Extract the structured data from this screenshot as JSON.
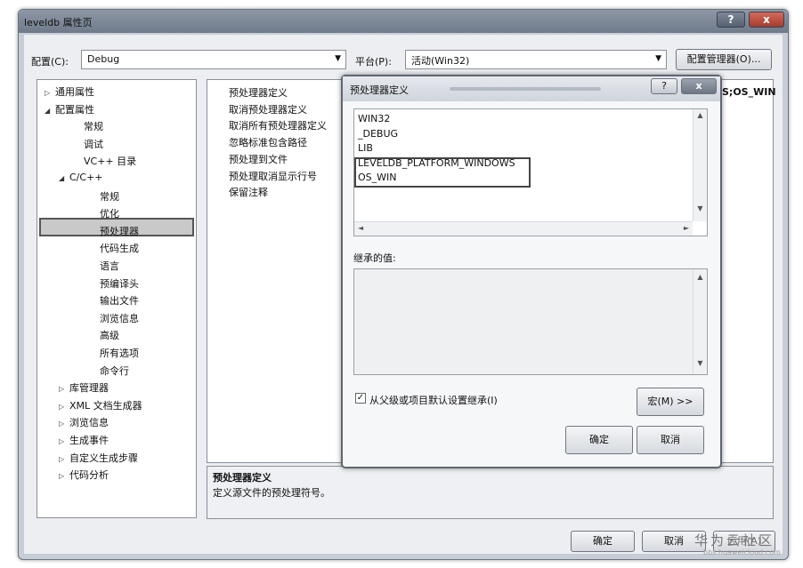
{
  "window": {
    "title": "leveldb 属性页",
    "help_label": "?",
    "close_label": "x"
  },
  "toolbar": {
    "config_label": "配置(C):",
    "config_value": "Debug",
    "platform_label": "平台(P):",
    "platform_value": "活动(Win32)",
    "config_manager_label": "配置管理器(O)..."
  },
  "tree": {
    "items": [
      {
        "label": "通用属性",
        "exp": "▷"
      },
      {
        "label": "配置属性",
        "exp": "◢"
      },
      {
        "label": "常规",
        "exp": ""
      },
      {
        "label": "调试",
        "exp": ""
      },
      {
        "label": "VC++ 目录",
        "exp": ""
      },
      {
        "label": "C/C++",
        "exp": "◢"
      },
      {
        "label": "常规",
        "exp": ""
      },
      {
        "label": "优化",
        "exp": ""
      },
      {
        "label": "预处理器",
        "exp": ""
      },
      {
        "label": "代码生成",
        "exp": ""
      },
      {
        "label": "语言",
        "exp": ""
      },
      {
        "label": "预编译头",
        "exp": ""
      },
      {
        "label": "输出文件",
        "exp": ""
      },
      {
        "label": "浏览信息",
        "exp": ""
      },
      {
        "label": "高级",
        "exp": ""
      },
      {
        "label": "所有选项",
        "exp": ""
      },
      {
        "label": "命令行",
        "exp": ""
      },
      {
        "label": "库管理器",
        "exp": "▷"
      },
      {
        "label": "XML 文档生成器",
        "exp": "▷"
      },
      {
        "label": "浏览信息",
        "exp": "▷"
      },
      {
        "label": "生成事件",
        "exp": "▷"
      },
      {
        "label": "自定义生成步骤",
        "exp": "▷"
      },
      {
        "label": "代码分析",
        "exp": "▷"
      }
    ]
  },
  "grid": {
    "rows": [
      "预处理器定义",
      "取消预处理器定义",
      "取消所有预处理器定义",
      "忽略标准包含路径",
      "预处理到文件",
      "预处理取消显示行号",
      "保留注释"
    ],
    "first_value_tail": "S;OS_WIN"
  },
  "description": {
    "title": "预处理器定义",
    "text": "定义源文件的预处理符号。"
  },
  "dialog": {
    "title": "预处理器定义",
    "help_label": "?",
    "close_label": "x",
    "lines": [
      "WIN32",
      "_DEBUG",
      "LIB",
      "LEVELDB_PLATFORM_WINDOWS",
      "OS_WIN"
    ],
    "inherited_label": "继承的值:",
    "inherit_checkbox_label": "从父级或项目默认设置继承(I)",
    "inherit_checked": true,
    "macro_button": "宏(M) >>",
    "ok_button": "确定",
    "cancel_button": "取消"
  },
  "footer": {
    "ok_button": "确定",
    "cancel_button": "取消",
    "apply_button": "应用(A)"
  },
  "watermark": {
    "brand": "华为云社区",
    "url": "bbs.huaweicloud.com"
  }
}
